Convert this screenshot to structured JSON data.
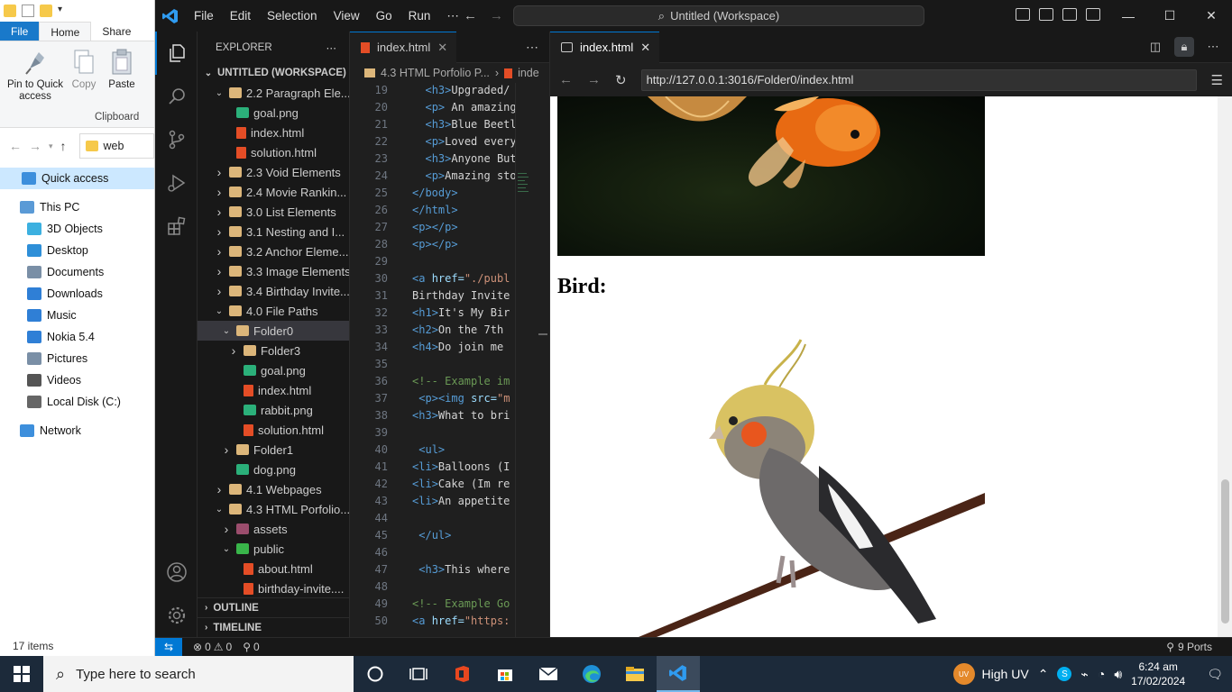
{
  "file_explorer": {
    "tabs": [
      "File",
      "Home",
      "Share"
    ],
    "ribbon": {
      "pin_label": "Pin to Quick access",
      "copy_label": "Copy",
      "paste_label": "Paste",
      "group_label": "Clipboard"
    },
    "address": "web",
    "nav": [
      {
        "label": "Quick access",
        "icon": "star-icon"
      },
      {
        "label": "This PC",
        "icon": "computer-icon"
      },
      {
        "label": "3D Objects",
        "icon": "cube-icon"
      },
      {
        "label": "Desktop",
        "icon": "desktop-icon"
      },
      {
        "label": "Documents",
        "icon": "documents-icon"
      },
      {
        "label": "Downloads",
        "icon": "download-icon"
      },
      {
        "label": "Music",
        "icon": "music-icon"
      },
      {
        "label": "Nokia 5.4",
        "icon": "phone-icon"
      },
      {
        "label": "Pictures",
        "icon": "pictures-icon"
      },
      {
        "label": "Videos",
        "icon": "videos-icon"
      },
      {
        "label": "Local Disk (C:)",
        "icon": "disk-icon"
      },
      {
        "label": "Network",
        "icon": "network-icon"
      }
    ],
    "status": "17 items"
  },
  "vscode": {
    "menu": [
      "File",
      "Edit",
      "Selection",
      "View",
      "Go",
      "Run",
      "⋯"
    ],
    "command_center": "Untitled (Workspace)",
    "explorer_title": "EXPLORER",
    "workspace": "UNTITLED (WORKSPACE)",
    "tree": [
      {
        "label": "2.2 Paragraph Ele...",
        "type": "folder",
        "open": true
      },
      {
        "label": "goal.png",
        "type": "img"
      },
      {
        "label": "index.html",
        "type": "html"
      },
      {
        "label": "solution.html",
        "type": "html"
      },
      {
        "label": "2.3 Void Elements",
        "type": "folder",
        "open": false
      },
      {
        "label": "2.4 Movie Rankin...",
        "type": "folder",
        "open": false
      },
      {
        "label": "3.0 List Elements",
        "type": "folder",
        "open": false
      },
      {
        "label": "3.1 Nesting and I...",
        "type": "folder",
        "open": false
      },
      {
        "label": "3.2 Anchor Eleme...",
        "type": "folder",
        "open": false
      },
      {
        "label": "3.3 Image Elements",
        "type": "folder",
        "open": false
      },
      {
        "label": "3.4 Birthday Invite...",
        "type": "folder",
        "open": false
      },
      {
        "label": "4.0 File Paths",
        "type": "folder",
        "open": true
      },
      {
        "label": "Folder0",
        "type": "folder",
        "open": true
      },
      {
        "label": "Folder3",
        "type": "folder",
        "open": false
      },
      {
        "label": "goal.png",
        "type": "img"
      },
      {
        "label": "index.html",
        "type": "html"
      },
      {
        "label": "rabbit.png",
        "type": "img"
      },
      {
        "label": "solution.html",
        "type": "html"
      },
      {
        "label": "Folder1",
        "type": "folder",
        "open": false
      },
      {
        "label": "dog.png",
        "type": "img"
      },
      {
        "label": "4.1 Webpages",
        "type": "folder",
        "open": false
      },
      {
        "label": "4.3 HTML Porfolio...",
        "type": "folder",
        "open": true
      },
      {
        "label": "assets",
        "type": "assets",
        "open": false
      },
      {
        "label": "public",
        "type": "public",
        "open": true
      },
      {
        "label": "about.html",
        "type": "html"
      },
      {
        "label": "birthday-invite....",
        "type": "html"
      }
    ],
    "outline_label": "OUTLINE",
    "timeline_label": "TIMELINE",
    "editor_tab": "index.html",
    "breadcrumb": [
      "4.3 HTML Porfolio P...",
      "inde"
    ],
    "code_lines": [
      {
        "n": "19",
        "t": "  <h3>Upgraded</"
      },
      {
        "n": "20",
        "t": "  <p> An amazing"
      },
      {
        "n": "21",
        "t": "  <h3>Blue Beetl"
      },
      {
        "n": "22",
        "t": "  <p>Loved every"
      },
      {
        "n": "23",
        "t": "  <h3>Anyone But"
      },
      {
        "n": "24",
        "t": "  <p>Amazing sto"
      },
      {
        "n": "25",
        "t": "</body>"
      },
      {
        "n": "26",
        "t": "</html>"
      },
      {
        "n": "27",
        "t": "<p></p>"
      },
      {
        "n": "28",
        "t": "<p></p>"
      },
      {
        "n": "29",
        "t": ""
      },
      {
        "n": "30",
        "t": "<a href=\"./publ"
      },
      {
        "n": "31",
        "t": "Birthday Invite"
      },
      {
        "n": "32",
        "t": "<h1>It's My Bir"
      },
      {
        "n": "33",
        "t": "<h2>On the 7th "
      },
      {
        "n": "34",
        "t": "<h4>Do join me "
      },
      {
        "n": "35",
        "t": ""
      },
      {
        "n": "36",
        "t": "<!-- Example im"
      },
      {
        "n": "37",
        "t": " <p><img src=\"m"
      },
      {
        "n": "38",
        "t": "<h3>What to bri"
      },
      {
        "n": "39",
        "t": ""
      },
      {
        "n": "40",
        "t": " <ul>"
      },
      {
        "n": "41",
        "t": "<li>Balloons (I"
      },
      {
        "n": "42",
        "t": "<li>Cake (Im re"
      },
      {
        "n": "43",
        "t": "<li>An appetite"
      },
      {
        "n": "44",
        "t": ""
      },
      {
        "n": "45",
        "t": " </ul>"
      },
      {
        "n": "46",
        "t": ""
      },
      {
        "n": "47",
        "t": " <h3>This where"
      },
      {
        "n": "48",
        "t": ""
      },
      {
        "n": "49",
        "t": "<!-- Example Go"
      },
      {
        "n": "50",
        "t": "<a href=\"https:"
      }
    ],
    "browser_tab": "index.html",
    "url": "http://127.0.0.1:3016/Folder0/index.html",
    "page_heading": "Bird:",
    "status": {
      "errors": "0",
      "warnings": "0",
      "ports_count": "0",
      "ports_label": "9 Ports"
    }
  },
  "taskbar": {
    "search_placeholder": "Type here to search",
    "weather": "High UV",
    "weather_badge": "UV",
    "time": "6:24 am",
    "date": "17/02/2024"
  }
}
